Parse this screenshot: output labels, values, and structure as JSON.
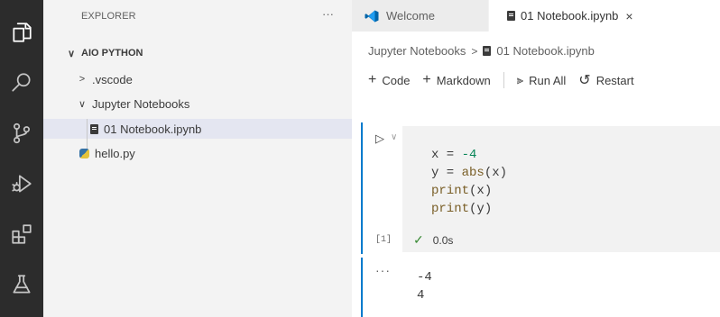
{
  "activity_bar": {
    "items": [
      {
        "icon": "explorer-icon"
      },
      {
        "icon": "search-icon"
      },
      {
        "icon": "source-control-icon"
      },
      {
        "icon": "run-debug-icon"
      },
      {
        "icon": "extensions-icon"
      },
      {
        "icon": "testing-icon"
      }
    ]
  },
  "sidebar": {
    "title": "EXPLORER",
    "more": "···",
    "workspace": "AIO PYTHON",
    "tree": [
      {
        "label": ".vscode",
        "chevron": ">",
        "type": "folder"
      },
      {
        "label": "Jupyter Notebooks",
        "chevron": "∨",
        "type": "folder"
      },
      {
        "label": "01 Notebook.ipynb",
        "type": "notebook",
        "selected": true
      },
      {
        "label": "hello.py",
        "type": "python"
      }
    ]
  },
  "tabs": [
    {
      "label": "Welcome",
      "active": false
    },
    {
      "label": "01 Notebook.ipynb",
      "active": true,
      "close": "×"
    }
  ],
  "breadcrumb": {
    "folder": "Jupyter Notebooks",
    "separator": ">",
    "file": "01 Notebook.ipynb"
  },
  "toolbar": {
    "code": "Code",
    "markdown": "Markdown",
    "run_all": "Run All",
    "restart": "Restart"
  },
  "cell": {
    "run_glyph": "▷",
    "chevron": "∨",
    "code_lines": [
      {
        "var": "x",
        "op": " = ",
        "val": "-4"
      },
      {
        "var": "y",
        "op": " = ",
        "fn": "abs",
        "arg": "x"
      },
      {
        "fn": "print",
        "arg": "x"
      },
      {
        "fn": "print",
        "arg": "y"
      }
    ],
    "execution_count": "[1]",
    "status_check": "✓",
    "duration": "0.0s"
  },
  "output": {
    "more": "···",
    "lines": [
      "-4",
      "4"
    ]
  }
}
